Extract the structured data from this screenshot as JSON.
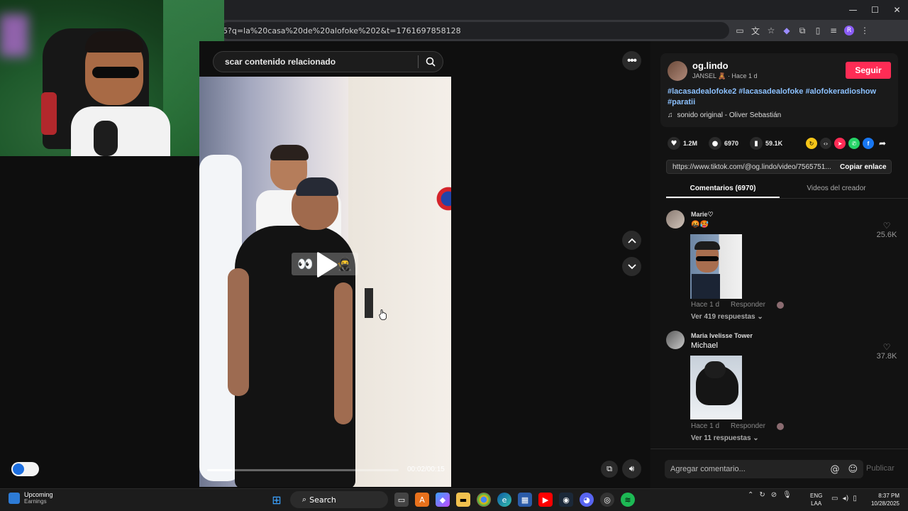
{
  "browser": {
    "url": "5?q=la%20casa%20de%20alofoke%202&t=1761697858128",
    "window_controls": [
      "—",
      "☐",
      "✕"
    ],
    "extension_icons": [
      "monitor-icon",
      "translate-icon",
      "star-icon",
      "copilot-icon",
      "extensions-icon",
      "split-icon",
      "media-icon",
      "profile-icon",
      "menu-icon"
    ],
    "profile_initial": "R"
  },
  "player": {
    "search_placeholder": "scar contenido relacionado",
    "overlay_emojis": [
      "👀",
      "🥷"
    ],
    "progress": 0.13,
    "time": "00:02/00:15",
    "more_label": "•••"
  },
  "creator": {
    "username": "og.lindo",
    "display_name": "JANSEL",
    "emoji": "🧸",
    "posted": "· Hace 1 d",
    "follow_label": "Seguir",
    "hashtags": "#lacasadealofoke2 #lacasadealofoke #alofokeradioshow #paratii",
    "sound": "sonido original - Oliver Sebastián"
  },
  "stats": {
    "likes": "1.2M",
    "comments": "6970",
    "saves": "59.1K"
  },
  "share": {
    "link": "https://www.tiktok.com/@og.lindo/video/7565751...",
    "copy_label": "Copiar enlace"
  },
  "tabs": {
    "comments": "Comentarios (6970)",
    "videos": "Videos del creador"
  },
  "comments": [
    {
      "name": "Marie♡",
      "text": "🤬🥵",
      "time": "Hace 1 d",
      "reply": "Responder",
      "replies": "Ver 419 respuestas ⌄",
      "likes": "25.6K"
    },
    {
      "name": "Maria Ivelisse Tower",
      "text": "Michael",
      "time": "Hace 1 d",
      "reply": "Responder",
      "replies": "Ver 11 respuestas ⌄",
      "likes": "37.8K"
    }
  ],
  "comment_box": {
    "placeholder": "Agregar comentario...",
    "publish": "Publicar"
  },
  "taskbar": {
    "weather_title": "Upcoming",
    "weather_sub": "Earnings",
    "search": "Search",
    "lang_top": "ENG",
    "lang_bottom": "LAA",
    "time": "8:37 PM",
    "date": "10/28/2025"
  },
  "colors": {
    "accent": "#fe2c55",
    "hashtag": "#8cc1ff",
    "background": "#121212"
  }
}
